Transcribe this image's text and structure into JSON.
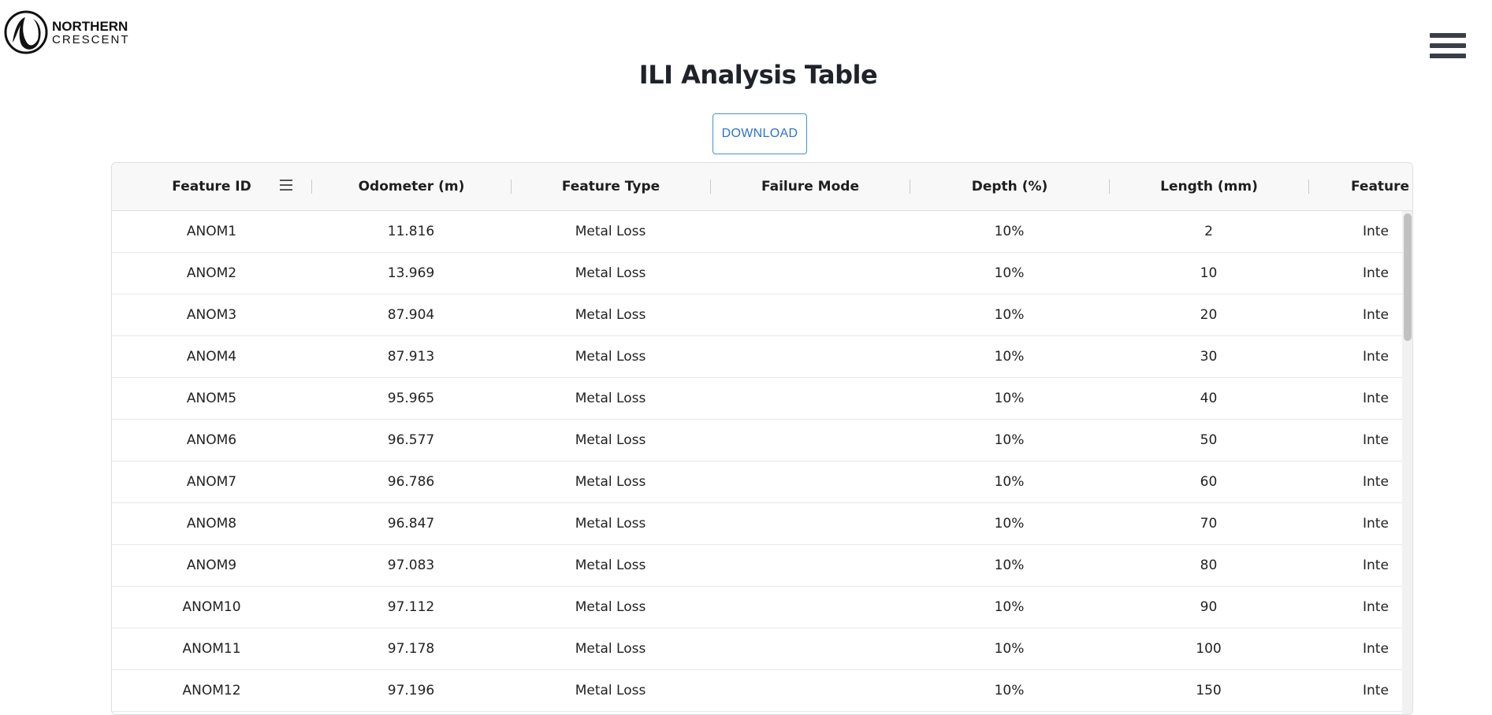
{
  "brand": {
    "line1": "NORTHERN",
    "line2": "CRESCENT"
  },
  "page": {
    "title": "ILI Analysis Table",
    "download_label": "DOWNLOAD"
  },
  "table": {
    "columns": [
      "Feature ID",
      "Odometer (m)",
      "Feature Type",
      "Failure Mode",
      "Depth (%)",
      "Length (mm)",
      "Feature Ra"
    ],
    "rows": [
      [
        "ANOM1",
        "11.816",
        "Metal Loss",
        "",
        "10%",
        "2",
        "Inte"
      ],
      [
        "ANOM2",
        "13.969",
        "Metal Loss",
        "",
        "10%",
        "10",
        "Inte"
      ],
      [
        "ANOM3",
        "87.904",
        "Metal Loss",
        "",
        "10%",
        "20",
        "Inte"
      ],
      [
        "ANOM4",
        "87.913",
        "Metal Loss",
        "",
        "10%",
        "30",
        "Inte"
      ],
      [
        "ANOM5",
        "95.965",
        "Metal Loss",
        "",
        "10%",
        "40",
        "Inte"
      ],
      [
        "ANOM6",
        "96.577",
        "Metal Loss",
        "",
        "10%",
        "50",
        "Inte"
      ],
      [
        "ANOM7",
        "96.786",
        "Metal Loss",
        "",
        "10%",
        "60",
        "Inte"
      ],
      [
        "ANOM8",
        "96.847",
        "Metal Loss",
        "",
        "10%",
        "70",
        "Inte"
      ],
      [
        "ANOM9",
        "97.083",
        "Metal Loss",
        "",
        "10%",
        "80",
        "Inte"
      ],
      [
        "ANOM10",
        "97.112",
        "Metal Loss",
        "",
        "10%",
        "90",
        "Inte"
      ],
      [
        "ANOM11",
        "97.178",
        "Metal Loss",
        "",
        "10%",
        "100",
        "Inte"
      ],
      [
        "ANOM12",
        "97.196",
        "Metal Loss",
        "",
        "10%",
        "150",
        "Inte"
      ]
    ]
  },
  "icons": {
    "logo": "crescent-logo-icon",
    "menu": "hamburger-menu-icon",
    "column_menu": "column-menu-icon"
  },
  "colors": {
    "accent": "#2a74c7",
    "menu_icon": "#3a3e4a",
    "header_bg": "#f8f8f8",
    "border": "#dcdfe3"
  }
}
